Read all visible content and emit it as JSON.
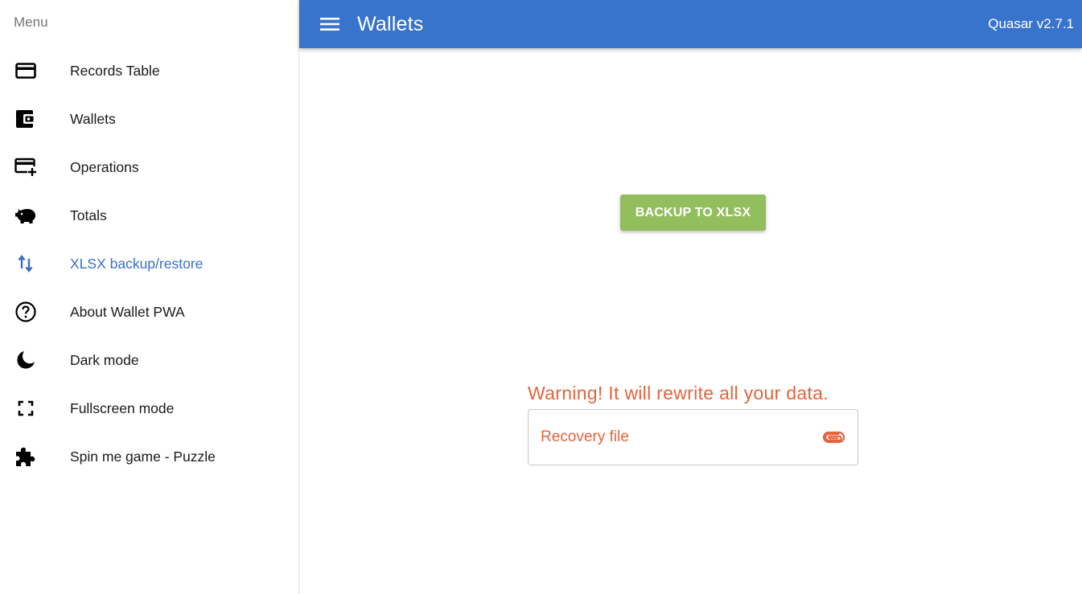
{
  "sidebar": {
    "header": "Menu",
    "items": [
      {
        "label": "Records Table",
        "icon": "credit-card-icon",
        "active": false
      },
      {
        "label": "Wallets",
        "icon": "wallet-icon",
        "active": false
      },
      {
        "label": "Operations",
        "icon": "add-card-icon",
        "active": false
      },
      {
        "label": "Totals",
        "icon": "piggy-bank-icon",
        "active": false
      },
      {
        "label": "XLSX backup/restore",
        "icon": "swap-vert-icon",
        "active": true
      },
      {
        "label": "About Wallet PWA",
        "icon": "help-circle-icon",
        "active": false
      },
      {
        "label": "Dark mode",
        "icon": "moon-icon",
        "active": false
      },
      {
        "label": "Fullscreen mode",
        "icon": "fullscreen-icon",
        "active": false
      },
      {
        "label": "Spin me game - Puzzle",
        "icon": "puzzle-icon",
        "active": false
      }
    ]
  },
  "header": {
    "title": "Wallets",
    "version": "Quasar v2.7.1"
  },
  "main": {
    "backup_button": "BACKUP TO XLSX",
    "warning": "Warning! It will rewrite all your data.",
    "file_input_placeholder": "Recovery file"
  },
  "colors": {
    "header_bg": "#3874cb",
    "active_item": "#3a6fc6",
    "backup_button": "#93be5e",
    "warning": "#e4643c"
  }
}
